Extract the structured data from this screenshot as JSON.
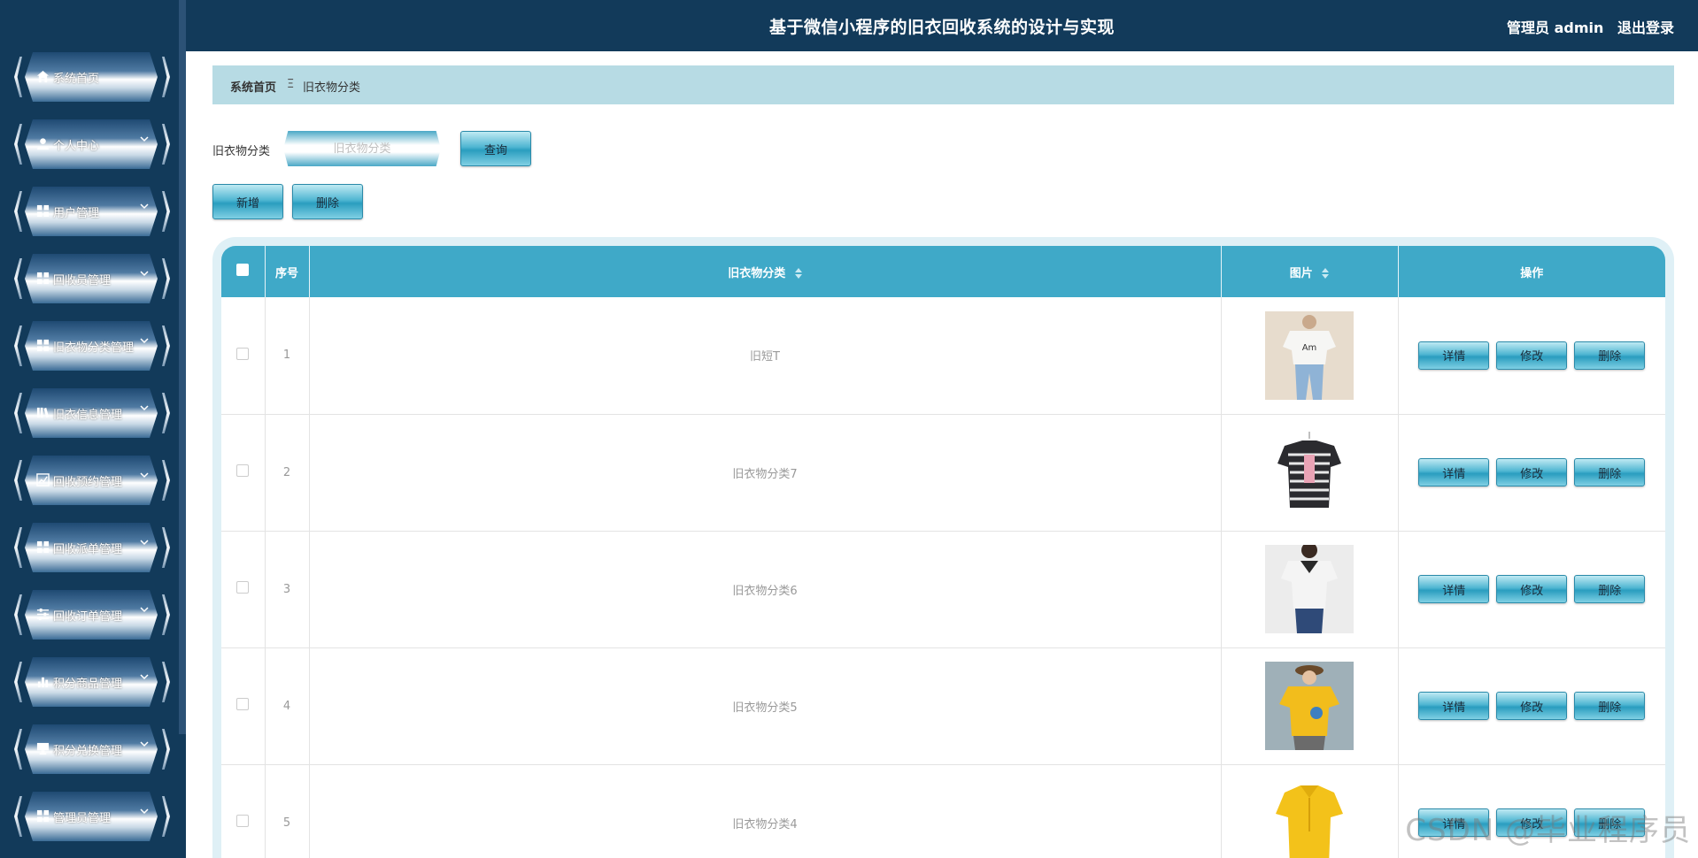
{
  "header": {
    "title": "基于微信小程序的旧衣回收系统的设计与实现",
    "user_label": "管理员 admin",
    "logout_label": "退出登录",
    "bg_color": "#123a5a"
  },
  "sidebar": {
    "items": [
      {
        "label": "系统首页",
        "icon": "home-icon"
      },
      {
        "label": "个人中心",
        "icon": "user-icon"
      },
      {
        "label": "用户管理",
        "icon": "grid-icon"
      },
      {
        "label": "回收员管理",
        "icon": "grid-icon"
      },
      {
        "label": "旧衣物分类管理",
        "icon": "grid-icon"
      },
      {
        "label": "旧衣信息管理",
        "icon": "book-icon"
      },
      {
        "label": "回收预约管理",
        "icon": "chart-line-icon"
      },
      {
        "label": "回收派单管理",
        "icon": "grid-icon"
      },
      {
        "label": "回收订单管理",
        "icon": "sliders-icon"
      },
      {
        "label": "积分商品管理",
        "icon": "bar-chart-icon"
      },
      {
        "label": "积分兑换管理",
        "icon": "monitor-icon"
      },
      {
        "label": "管理员管理",
        "icon": "grid-icon"
      }
    ]
  },
  "breadcrumb": {
    "home": "系统首页",
    "separator": "Ξ",
    "current": "旧衣物分类"
  },
  "search": {
    "label": "旧衣物分类",
    "placeholder": "旧衣物分类",
    "query_label": "查询"
  },
  "actions": {
    "add_label": "新增",
    "delete_label": "删除"
  },
  "table": {
    "headers": {
      "index": "序号",
      "category": "旧衣物分类",
      "image": "图片",
      "operation": "操作"
    },
    "row_buttons": {
      "detail": "详情",
      "edit": "修改",
      "delete": "删除"
    },
    "rows": [
      {
        "index": "1",
        "category": "旧短T",
        "image": "white-tshirt-photo"
      },
      {
        "index": "2",
        "category": "旧衣物分类7",
        "image": "striped-tshirt-photo"
      },
      {
        "index": "3",
        "category": "旧衣物分类6",
        "image": "white-top-photo"
      },
      {
        "index": "4",
        "category": "旧衣物分类5",
        "image": "yellow-shirt-photo"
      },
      {
        "index": "5",
        "category": "旧衣物分类4",
        "image": "yellow-polo-photo"
      }
    ]
  },
  "watermark": "CSDN @毕业程序员"
}
